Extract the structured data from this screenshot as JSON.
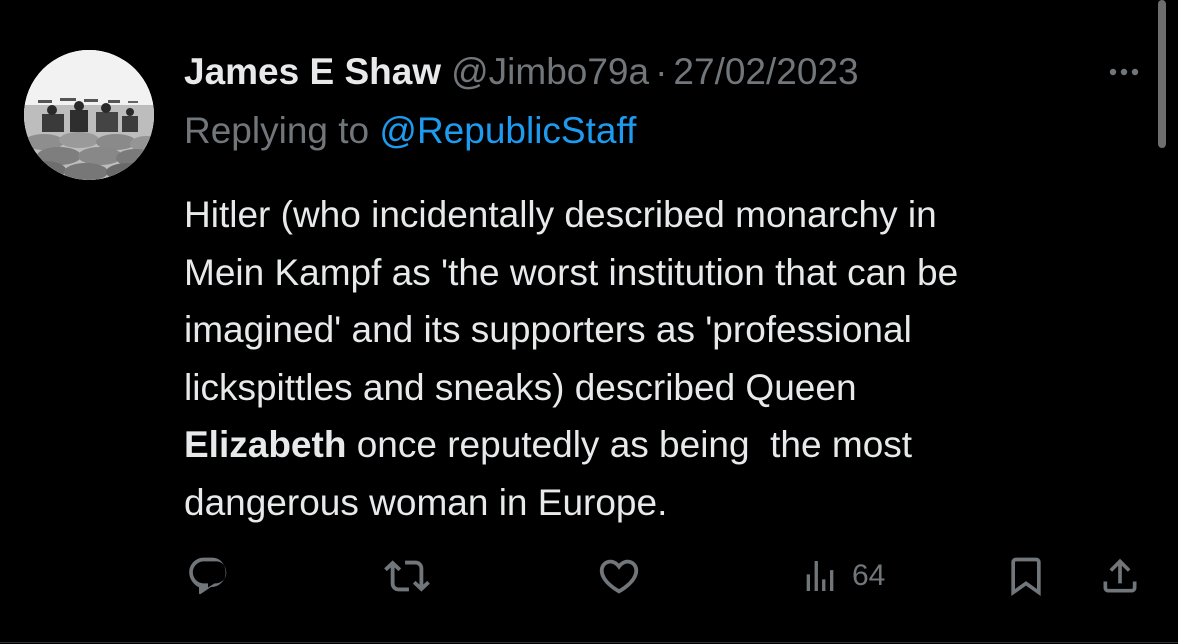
{
  "tweet": {
    "display_name": "James E Shaw",
    "handle": "@Jimbo79a",
    "separator": "·",
    "date": "27/02/2023",
    "replying_prefix": "Replying to ",
    "replying_to": "@RepublicStaff",
    "body_lines": [
      {
        "pre": "Hitler (who incidentally described monarchy in",
        "bold": "",
        "post": ""
      },
      {
        "pre": "Mein Kampf as 'the worst institution that can be",
        "bold": "",
        "post": ""
      },
      {
        "pre": "imagined' and its supporters as 'professional",
        "bold": "",
        "post": ""
      },
      {
        "pre": "lickspittles and sneaks) described Queen",
        "bold": "",
        "post": ""
      },
      {
        "pre": "",
        "bold": "Elizabeth",
        "post": " once reputedly as being  the most"
      },
      {
        "pre": "dangerous woman in Europe.",
        "bold": "",
        "post": ""
      }
    ]
  },
  "actions": {
    "reply_icon": "reply-icon",
    "retweet_icon": "retweet-icon",
    "like_icon": "like-icon",
    "views_icon": "views-icon",
    "views_count": "64",
    "bookmark_icon": "bookmark-icon",
    "share_icon": "share-icon"
  },
  "colors": {
    "background": "#000000",
    "text": "#e7e9ea",
    "secondary": "#71767b",
    "link": "#1d9bf0"
  }
}
